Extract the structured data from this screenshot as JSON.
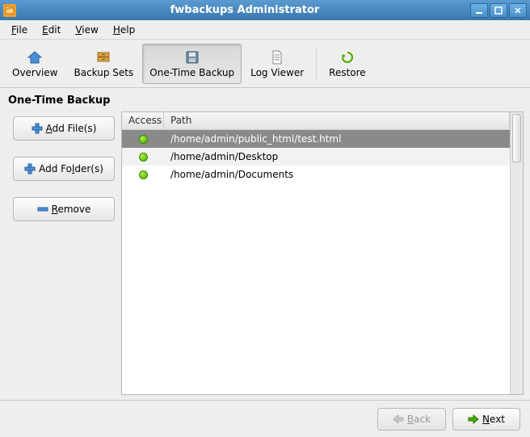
{
  "window": {
    "title": "fwbackups Administrator"
  },
  "menubar": [
    {
      "label": "File",
      "accel": "F"
    },
    {
      "label": "Edit",
      "accel": "E"
    },
    {
      "label": "View",
      "accel": "V"
    },
    {
      "label": "Help",
      "accel": "H"
    }
  ],
  "toolbar": {
    "overview": "Overview",
    "backup_sets": "Backup Sets",
    "one_time": "One-Time Backup",
    "log_viewer": "Log Viewer",
    "restore": "Restore",
    "active": "one_time"
  },
  "heading": "One-Time Backup",
  "side_buttons": {
    "add_files": "Add File(s)",
    "add_folders": "Add Folder(s)",
    "remove": "Remove"
  },
  "list": {
    "columns": {
      "access": "Access",
      "path": "Path"
    },
    "rows": [
      {
        "access": "ok",
        "path": "/home/admin/public_html/test.html",
        "selected": true
      },
      {
        "access": "ok",
        "path": "/home/admin/Desktop",
        "selected": false
      },
      {
        "access": "ok",
        "path": "/home/admin/Documents",
        "selected": false
      }
    ]
  },
  "footer": {
    "back": "Back",
    "next": "Next",
    "back_enabled": false
  }
}
